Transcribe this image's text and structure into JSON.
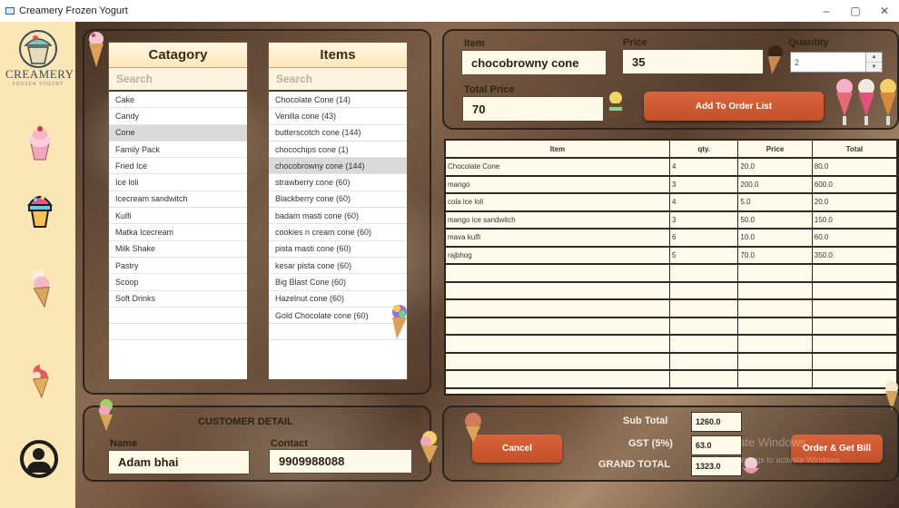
{
  "window": {
    "title": "Creamery Frozen Yogurt"
  },
  "window_controls": [
    "–",
    "▢",
    "✕"
  ],
  "logo": {
    "word": "CREAMERY",
    "tagline": "FROZEN YOGURT"
  },
  "category_panel": {
    "header": "Catagory",
    "search_placeholder": "Search",
    "items": [
      "Cake",
      "Candy",
      "Cone",
      "Family Pack",
      "Fried Ice",
      "Ice loli",
      "Icecream sandwitch",
      "Kulfi",
      "Matka Icecream",
      "Milk Shake",
      "Pastry",
      "Scoop",
      "Soft Drinks"
    ],
    "selected": "Cone"
  },
  "items_panel": {
    "header": "Items",
    "search_placeholder": "Search",
    "items": [
      "Chocolate Cone  (14)",
      "Venilla cone  (43)",
      "butterscotch cone  (144)",
      "chocochips cone  (1)",
      "chocobrowny cone  (144)",
      "strawberry cone  (60)",
      "Blackberry cone  (60)",
      "badam masti cone  (60)",
      "cookies n cream cone  (60)",
      "pista masti cone  (60)",
      "kesar pista cone  (60)",
      "Big Blast Cone  (60)",
      "Hazelnut cone  (60)",
      "Gold Chocolate cone  (60)"
    ],
    "selected": "chocobrowny cone  (144)"
  },
  "order_entry": {
    "item_label": "Item",
    "item_value": "chocobrowny cone",
    "price_label": "Price",
    "price_value": "35",
    "quantity_label": "Quantity",
    "quantity_value": "2",
    "total_price_label": "Total Price",
    "total_price_value": "70",
    "add_button": "Add To Order List"
  },
  "order_table": {
    "columns": [
      "Item",
      "qty.",
      "Price",
      "Total"
    ],
    "rows": [
      [
        "Chocolate Cone",
        "4",
        "20.0",
        "80.0"
      ],
      [
        "mango",
        "3",
        "200.0",
        "600.0"
      ],
      [
        "cola ice loli",
        "4",
        "5.0",
        "20.0"
      ],
      [
        "mango ice sandwitch",
        "3",
        "50.0",
        "150.0"
      ],
      [
        "mava kulfi",
        "6",
        "10.0",
        "60.0"
      ],
      [
        "rajbhog",
        "5",
        "70.0",
        "350.0"
      ]
    ],
    "empty_rows": 7
  },
  "customer": {
    "header": "CUSTOMER DETAIL",
    "name_label": "Name",
    "name_value": "Adam bhai",
    "contact_label": "Contact",
    "contact_value": "9909988088"
  },
  "billing": {
    "cancel_button": "Cancel",
    "subtotal_label": "Sub Total",
    "subtotal_value": "1260.0",
    "gst_label": "GST  (5%)",
    "gst_value": "63.0",
    "grand_total_label": "GRAND TOTAL",
    "grand_total_value": "1323.0",
    "order_button": "Order & Get Bill"
  },
  "watermark": {
    "line1": "Activate Windows",
    "line2": "Go to Settings to activate Windows."
  },
  "colors": {
    "sidebar": "#fbe6b5",
    "accent_button": "#c9542c",
    "field_bg": "#fff9e7"
  }
}
